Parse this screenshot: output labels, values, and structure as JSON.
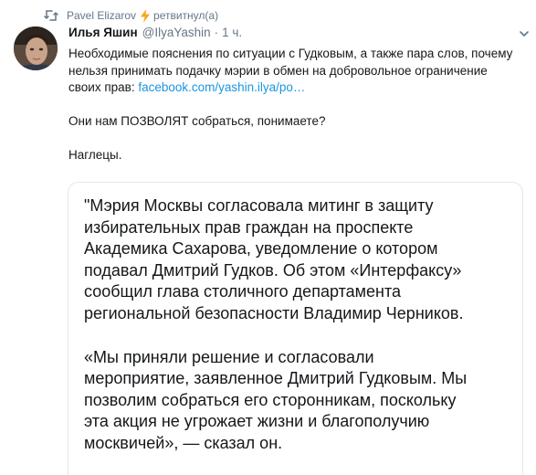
{
  "retweet": {
    "user": "Pavel Elizarov",
    "action": "ретвитнул(а)"
  },
  "tweet": {
    "author_name": "Илья Яшин",
    "author_handle": "@IlyaYashin",
    "separator": "·",
    "time": "1 ч.",
    "line1": "Необходимые пояснения по ситуации с Гудковым, а также пара слов, почему",
    "line2": "нельзя принимать подачку мэрии в обмен на добровольное ограничение",
    "line3_prefix": "своих прав: ",
    "link": "facebook.com/yashin.ilya/po…",
    "paragraph2": "Они нам ПОЗВОЛЯТ собраться, понимаете?",
    "paragraph3": "Наглецы."
  },
  "quote": {
    "lines_a": [
      "\"Мэрия Москвы согласовала митинг в защиту",
      "избирательных  прав граждан на проспекте",
      "Академика Сахарова, уведомление о котором",
      "подавал Дмитрий Гудков. Об этом «Интерфаксу»",
      "сообщил глава столичного департамента",
      "региональной безопасности Владимир Черников."
    ],
    "lines_b": [
      "«Мы приняли решение и согласовали",
      "мероприятие, заявленное Дмитрий Гудковым. Мы",
      "позволим собраться его сторонникам, поскольку",
      "эта акция не угрожает жизни и благополучию",
      "москвичей», — сказал он."
    ]
  },
  "icons": {
    "retweet": "retweet-icon",
    "bolt": "lightning-bolt-icon",
    "chevron": "chevron-down-icon"
  },
  "colors": {
    "secondary_text": "#657786",
    "link": "#1b95e0",
    "bolt": "#f5a623",
    "border": "#e1e8ed"
  }
}
